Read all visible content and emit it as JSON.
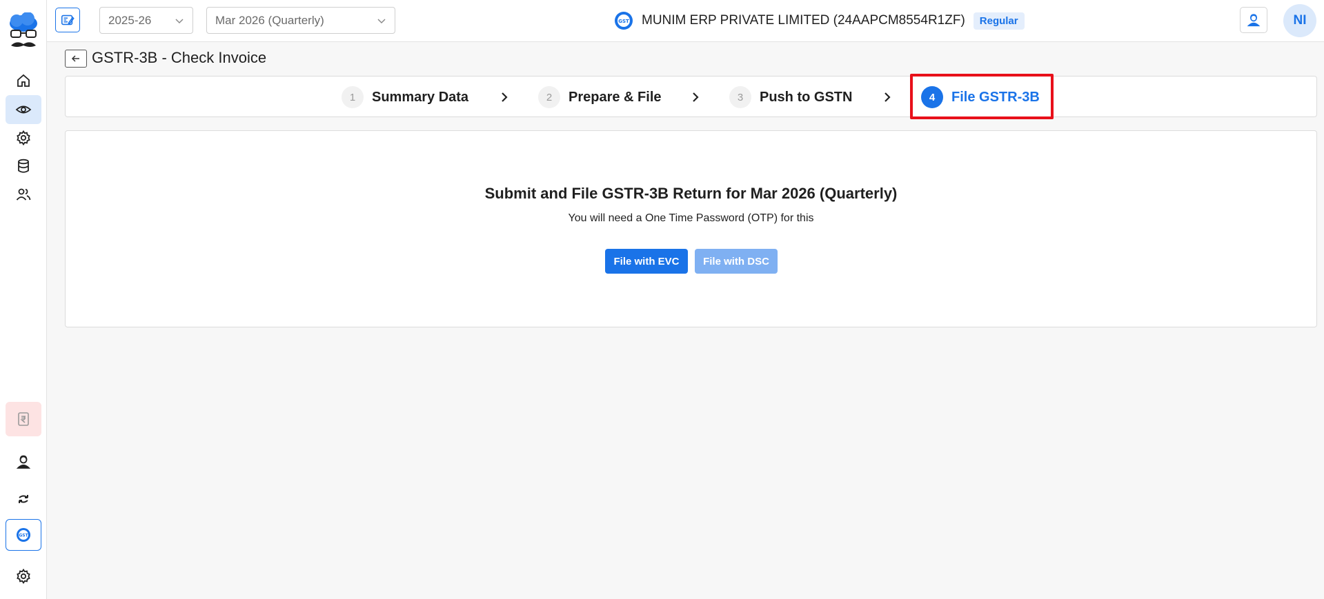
{
  "sidebar": {
    "items": [
      {
        "name": "home",
        "icon": "home-icon"
      },
      {
        "name": "view",
        "icon": "eye-icon",
        "active": true
      },
      {
        "name": "settings",
        "icon": "gear-icon"
      },
      {
        "name": "database",
        "icon": "database-icon"
      },
      {
        "name": "users",
        "icon": "users-icon"
      }
    ],
    "bottom_items": [
      {
        "name": "payment",
        "icon": "rupee-icon"
      },
      {
        "name": "support",
        "icon": "agent-icon"
      },
      {
        "name": "sync",
        "icon": "sync-icon"
      },
      {
        "name": "gst",
        "icon": "gst-icon"
      },
      {
        "name": "settings",
        "icon": "gear-icon"
      }
    ]
  },
  "topbar": {
    "financial_year": "2025-26",
    "period": "Mar 2026 (Quarterly)",
    "company_name": "MUNIM ERP PRIVATE LIMITED (24AAPCM8554R1ZF)",
    "company_badge": "Regular",
    "avatar_initials": "NI"
  },
  "page": {
    "title": "GSTR-3B - Check Invoice"
  },
  "stepper": {
    "steps": [
      {
        "number": "1",
        "label": "Summary Data"
      },
      {
        "number": "2",
        "label": "Prepare & File"
      },
      {
        "number": "3",
        "label": "Push to GSTN"
      },
      {
        "number": "4",
        "label": "File GSTR-3B",
        "active": true
      }
    ]
  },
  "panel": {
    "heading": "Submit and File GSTR-3B Return for Mar 2026 (Quarterly)",
    "subtext": "You will need a One Time Password (OTP) for this",
    "evc_button": "File with EVC",
    "dsc_button": "File with DSC"
  },
  "colors": {
    "accent": "#1a73e8",
    "accent_light": "#7fb0f2",
    "highlight": "#e8101a"
  }
}
